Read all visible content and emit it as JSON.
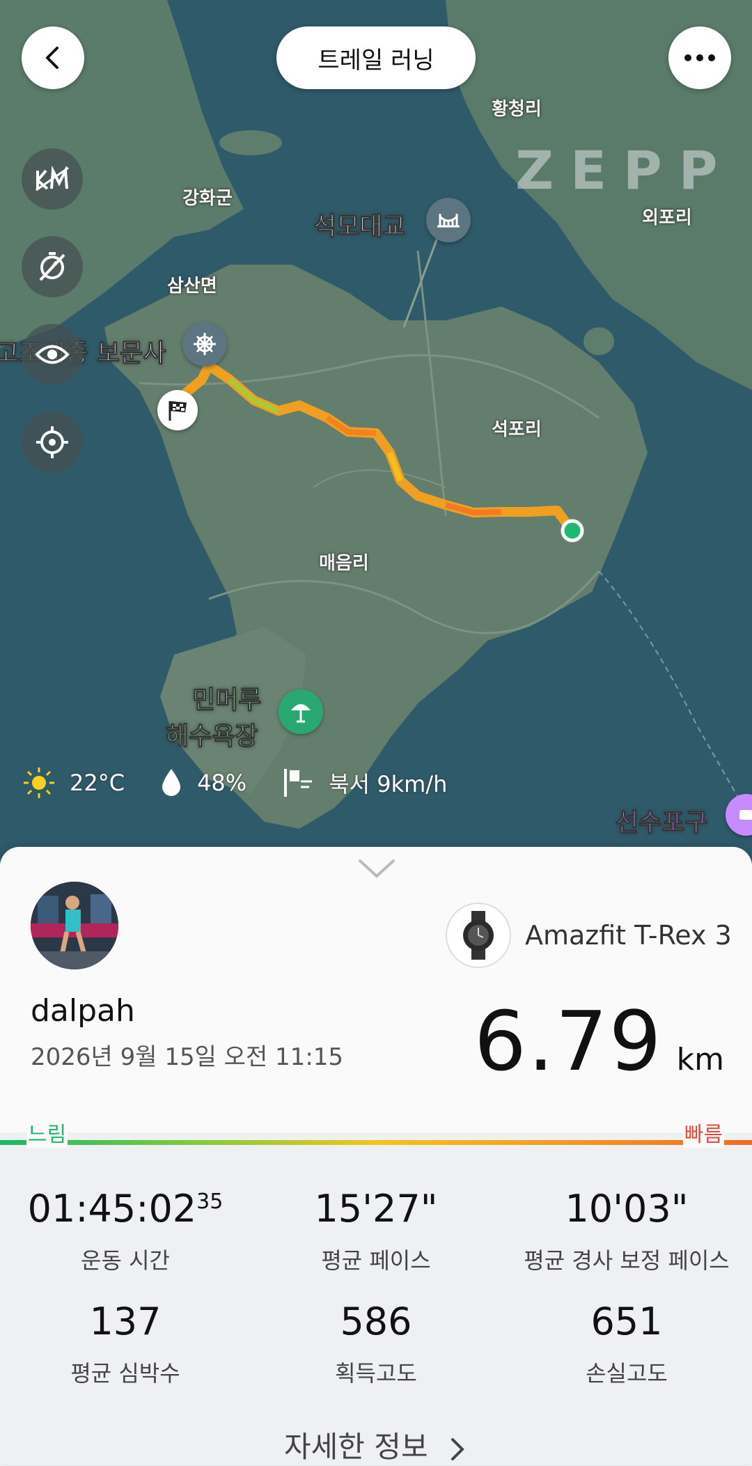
{
  "header": {
    "title": "트레일 러닝",
    "back_icon": "chevron-left-icon",
    "more_icon": "more-horizontal-icon"
  },
  "map": {
    "watermark": "ZEPP",
    "places": {
      "hwangcheong": "황청리",
      "ganghwa": "강화군",
      "oepo": "외포리",
      "samsan": "삼산면",
      "seokpo": "석포리",
      "maeeum": "매음리"
    },
    "pois": {
      "seokmo_bridge": "석모대교",
      "bomunsa": "고조계종 보문사",
      "minmeoru_1": "민머루",
      "minmeoru_2": "해수욕장",
      "seonsu": "선수포구"
    },
    "side_buttons": [
      "km-marker-icon",
      "pace-off-icon",
      "eye-icon",
      "locate-icon"
    ],
    "route_colors": [
      "#f5c21a",
      "#f28a1e",
      "#9bd23a",
      "#1fb870"
    ]
  },
  "weather": {
    "temperature": "22°C",
    "humidity": "48%",
    "wind": "북서 9km/h"
  },
  "summary": {
    "device": "Amazfit T-Rex 3",
    "username": "dalpah",
    "datetime": "2026년 9월 15일 오전 11:15",
    "distance": "6.79",
    "distance_unit": "km",
    "legend_slow": "느림",
    "legend_fast": "빠름",
    "stats": [
      {
        "value": "01:45:02",
        "sub": "35",
        "label": "운동 시간"
      },
      {
        "value": "15'27\"",
        "label": "평균 페이스"
      },
      {
        "value": "10'03\"",
        "label": "평균 경사 보정 페이스"
      },
      {
        "value": "137",
        "label": "평균 심박수"
      },
      {
        "value": "586",
        "label": "획득고도"
      },
      {
        "value": "651",
        "label": "손실고도"
      }
    ],
    "more_label": "자세한 정보",
    "colors": {
      "slow": "#1fb870",
      "fast": "#e84a3a"
    }
  }
}
